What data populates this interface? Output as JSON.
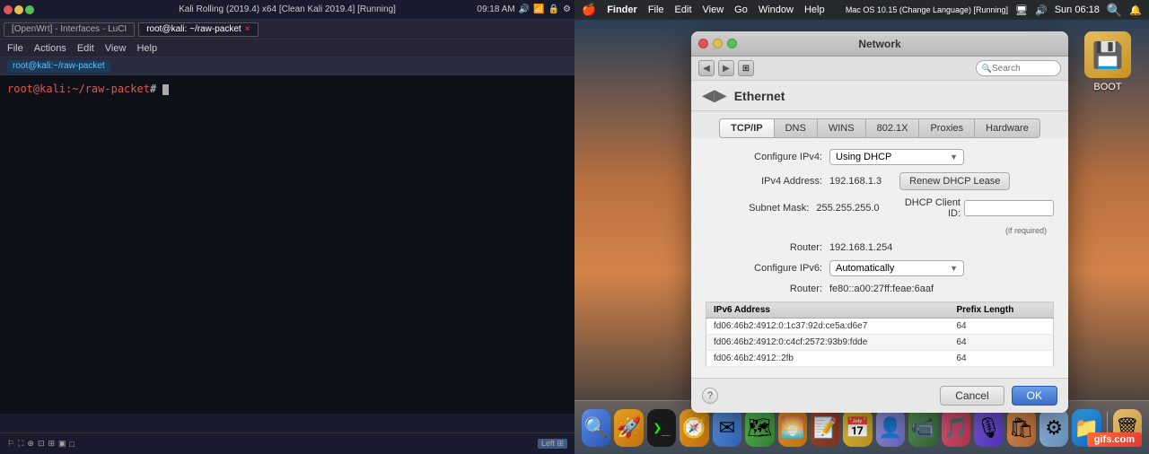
{
  "kali": {
    "window_title": "root@kali: ~/raw-packet",
    "os_label": "Kali Rolling (2019.4) x64 [Clean Kali 2019.4] [Running]",
    "tab1_label": "[OpenWrt] - Interfaces - LuCI",
    "tab2_label": "root@kali: ~/raw-packet",
    "tab2_close": "×",
    "menu_file": "File",
    "menu_actions": "Actions",
    "menu_edit": "Edit",
    "menu_view": "View",
    "menu_help": "Help",
    "path_label": "root@kali:~/raw-packet",
    "prompt_text": "root@kali:~/raw-packet",
    "prompt_suffix": "# ",
    "time": "09:18 AM",
    "status_items": [
      "⚐",
      "⛶",
      "⊕",
      "⊡",
      "⊞",
      "▣",
      "□"
    ],
    "keyboard_status": "Left ⊞"
  },
  "mac": {
    "os_label": "Mac OS 10.15 (Change Language) [Running]",
    "menu_apple": "",
    "menu_finder": "Finder",
    "menu_file": "File",
    "menu_edit": "Edit",
    "menu_view": "View",
    "menu_go": "Go",
    "menu_window": "Window",
    "menu_help": "Help",
    "time": "Sun 06:18",
    "boot_label": "BOOT"
  },
  "dialog": {
    "title": "Network",
    "back_label": "Ethernet",
    "search_placeholder": "Search",
    "tabs": [
      "TCP/IP",
      "DNS",
      "WINS",
      "802.1X",
      "Proxies",
      "Hardware"
    ],
    "active_tab": "TCP/IP",
    "configure_ipv4_label": "Configure IPv4:",
    "configure_ipv4_value": "Using DHCP",
    "ipv4_address_label": "IPv4 Address:",
    "ipv4_address_value": "192.168.1.3",
    "renew_btn_label": "Renew DHCP Lease",
    "subnet_mask_label": "Subnet Mask:",
    "subnet_mask_value": "255.255.255.0",
    "dhcp_client_id_label": "DHCP Client ID:",
    "if_required": "(if required)",
    "router_ipv4_label": "Router:",
    "router_ipv4_value": "192.168.1.254",
    "configure_ipv6_label": "Configure IPv6:",
    "configure_ipv6_value": "Automatically",
    "router_ipv6_label": "Router:",
    "router_ipv6_value": "fe80::a00:27ff:feae:6aaf",
    "ipv6_table_col1": "IPv6 Address",
    "ipv6_table_col2": "Prefix Length",
    "ipv6_rows": [
      {
        "address": "fd06:46b2:4912:0:1c37:92d:ce5a:d6e7",
        "prefix": "64"
      },
      {
        "address": "fd06:46b2:4912:0:c4cf:2572:93b9:fdde",
        "prefix": "64"
      },
      {
        "address": "fd06:46b2:4912::2fb",
        "prefix": "64"
      }
    ],
    "help_label": "?",
    "cancel_label": "Cancel",
    "ok_label": "OK"
  },
  "dock_icons": [
    "🔍",
    "🚀",
    "💻",
    "📝",
    "🗂",
    "📧",
    "📷",
    "📁",
    "🎵",
    "🎬",
    "⚙",
    "🛒",
    "🎙",
    "📱",
    "🔊",
    "💿"
  ],
  "gifs_badge": "gifs.com"
}
